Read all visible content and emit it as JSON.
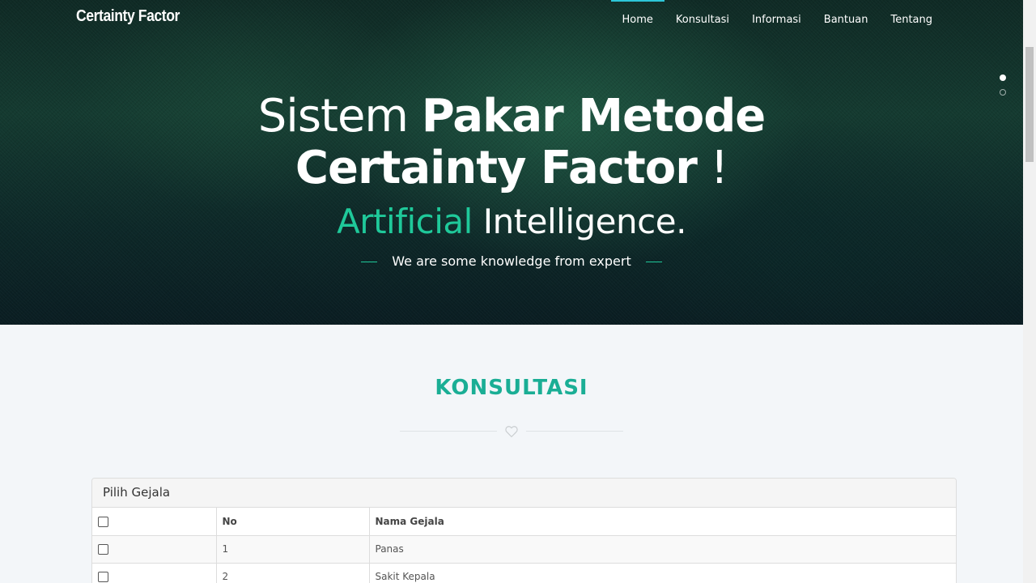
{
  "navbar": {
    "brand": "Certainty Factor",
    "items": [
      {
        "label": "Home",
        "active": true
      },
      {
        "label": "Konsultasi",
        "active": false
      },
      {
        "label": "Informasi",
        "active": false
      },
      {
        "label": "Bantuan",
        "active": false
      },
      {
        "label": "Tentang",
        "active": false
      }
    ]
  },
  "hero": {
    "line1_thin": "Sistem ",
    "line1_bold": "Pakar Metode",
    "line2_bold": "Certainty Factor",
    "line2_thin": " !",
    "line3_accent": "Artificial",
    "line3_rest": " Intelligence.",
    "tagline": "We are some knowledge from expert",
    "slides": 2,
    "active_slide": 1
  },
  "section": {
    "title": "KONSULTASI",
    "divider_icon": "heart-icon"
  },
  "panel": {
    "heading": "Pilih Gejala",
    "columns": [
      "No",
      "Nama Gejala"
    ],
    "rows": [
      {
        "no": "1",
        "nama": "Panas"
      },
      {
        "no": "2",
        "nama": "Sakit Kepala"
      }
    ]
  },
  "colors": {
    "accent": "#1fc99a",
    "section_title": "#1aae95",
    "nav_active": "#2dc6d8"
  }
}
